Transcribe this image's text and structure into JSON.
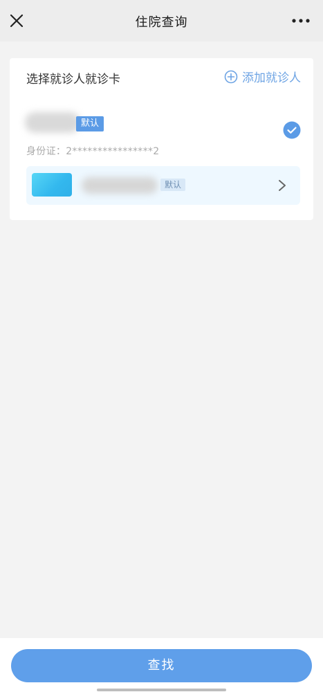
{
  "header": {
    "title": "住院查询",
    "close_icon": "close-icon",
    "more_icon": "more-icon"
  },
  "patient_section": {
    "heading": "选择就诊人就诊卡",
    "add_patient_label": "添加就诊人",
    "add_icon": "plus-circle-icon",
    "patient": {
      "default_badge": "默认",
      "id_line": "身份证：2****************2",
      "selected": true
    },
    "medical_card": {
      "default_badge": "默认"
    }
  },
  "footer": {
    "search_label": "查找"
  },
  "colors": {
    "accent": "#5f9fea",
    "link": "#6ea4e4",
    "background": "#f3f3f3",
    "card_row_bg": "#eef8ff"
  }
}
